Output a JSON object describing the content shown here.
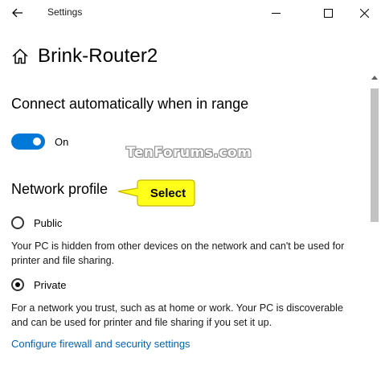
{
  "window": {
    "title": "Settings",
    "accent_color": "#0078d7"
  },
  "header": {
    "title": "Brink-Router2"
  },
  "connect_auto": {
    "heading": "Connect automatically when in range",
    "toggle_state": "On",
    "toggle_on": true
  },
  "watermark": "TenForums.com",
  "network_profile": {
    "heading": "Network profile",
    "callout": "Select",
    "options": [
      {
        "label": "Public",
        "selected": false,
        "description": "Your PC is hidden from other devices on the network and can't be used for printer and file sharing."
      },
      {
        "label": "Private",
        "selected": true,
        "description": "For a network you trust, such as at home or work. Your PC is discoverable and can be used for printer and file sharing if you set it up."
      }
    ]
  },
  "firewall_link": "Configure firewall and security settings",
  "icons": [
    "back-arrow-icon",
    "minimize-icon",
    "maximize-icon",
    "close-icon",
    "home-icon",
    "scroll-up-icon"
  ]
}
